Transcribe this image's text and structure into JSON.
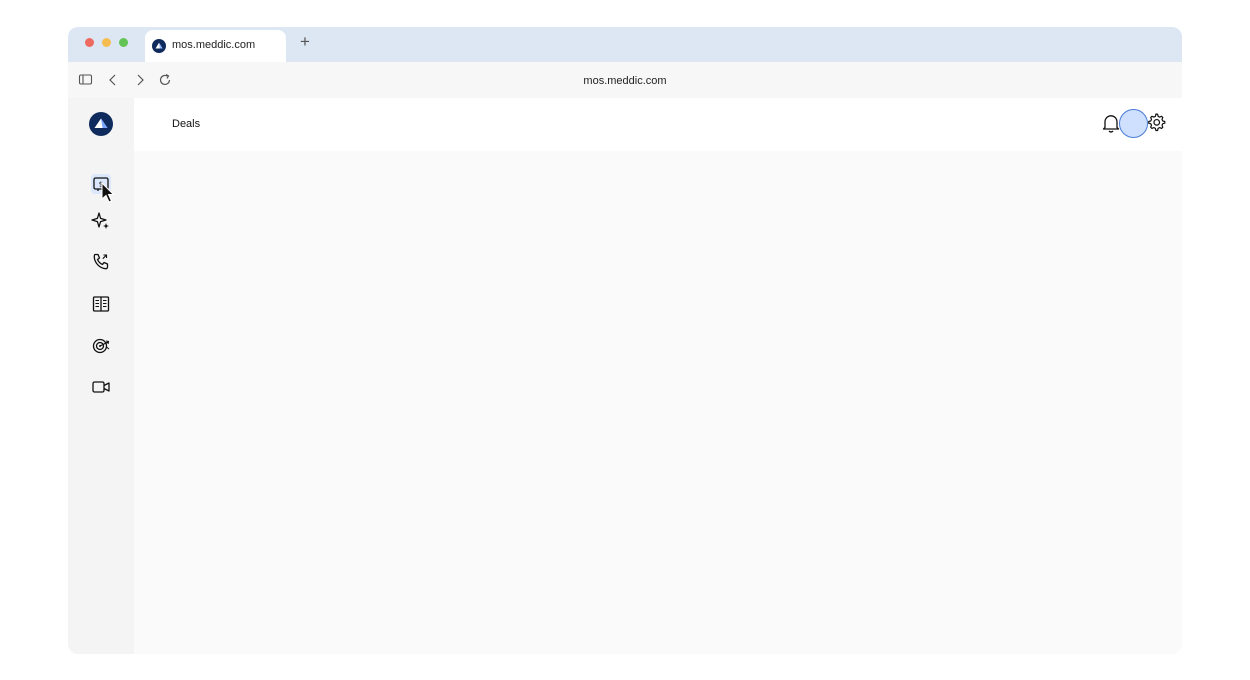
{
  "browser": {
    "tab_title": "mos.meddic.com",
    "new_tab_label": "+",
    "url": "mos.meddic.com",
    "traffic_colors": {
      "close": "#ee6a5f",
      "minimize": "#f5bd4f",
      "zoom": "#61c454"
    }
  },
  "sidebar": {
    "logo": "meddic-logo",
    "items": [
      {
        "icon": "deals-icon",
        "active": true
      },
      {
        "icon": "sparkle-icon"
      },
      {
        "icon": "phone-call-icon"
      },
      {
        "icon": "book-icon"
      },
      {
        "icon": "target-icon"
      },
      {
        "icon": "video-icon"
      }
    ]
  },
  "header": {
    "title": "Deals",
    "notifications_icon": "bell-icon",
    "settings_icon": "gear-icon",
    "avatar": "avatar"
  },
  "colors": {
    "brand": "#0f2a5c",
    "accent": "#4a7bd6",
    "tabbar": "#dde7f3"
  }
}
